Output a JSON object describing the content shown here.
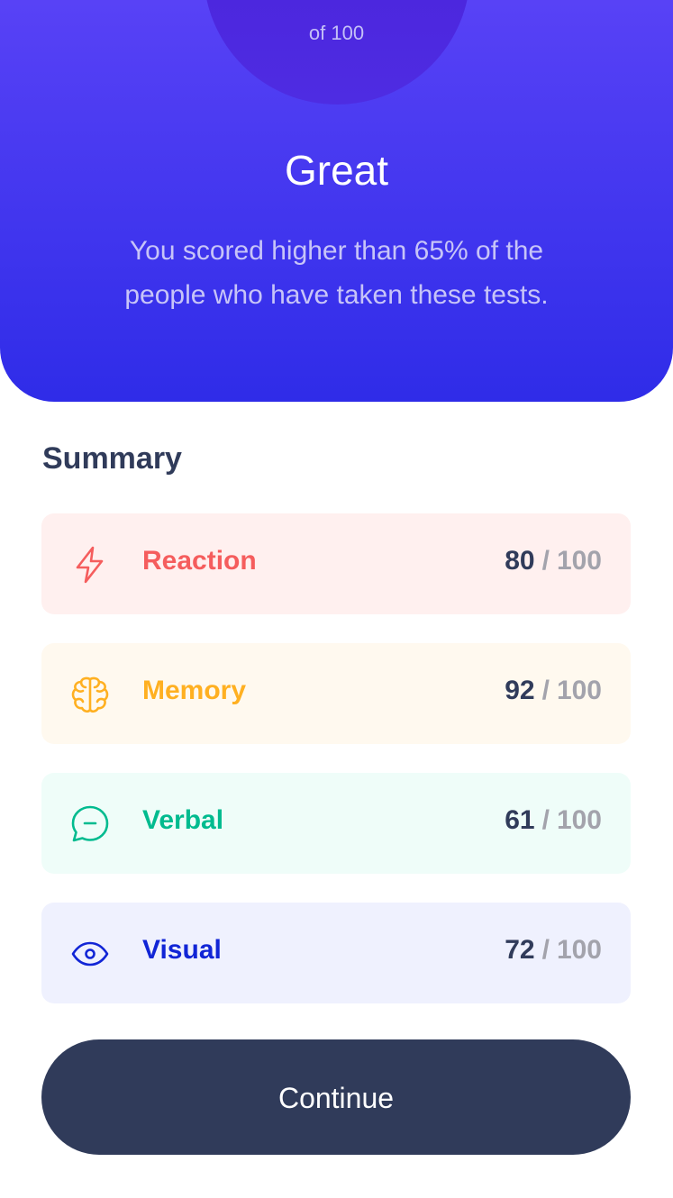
{
  "result": {
    "of_total": "of 100",
    "title": "Great",
    "description": "You scored higher than 65% of the people who have taken these tests."
  },
  "summary": {
    "heading": "Summary",
    "items": [
      {
        "label": "Reaction",
        "score": "80",
        "separator": "/",
        "max": "100",
        "icon": "lightning-icon",
        "color": "#f55d5d",
        "bg": "#fff0ef"
      },
      {
        "label": "Memory",
        "score": "92",
        "separator": "/",
        "max": "100",
        "icon": "brain-icon",
        "color": "#ffb021",
        "bg": "#fff9ef"
      },
      {
        "label": "Verbal",
        "score": "61",
        "separator": "/",
        "max": "100",
        "icon": "chat-bubble-icon",
        "color": "#00bb8f",
        "bg": "#effdf9"
      },
      {
        "label": "Visual",
        "score": "72",
        "separator": "/",
        "max": "100",
        "icon": "eye-icon",
        "color": "#1125d6",
        "bg": "#eff1fe"
      }
    ]
  },
  "actions": {
    "continue_label": "Continue"
  },
  "colors": {
    "hero_top": "#5842f6",
    "hero_bottom": "#2f2ce8",
    "dark": "#303b5a"
  }
}
